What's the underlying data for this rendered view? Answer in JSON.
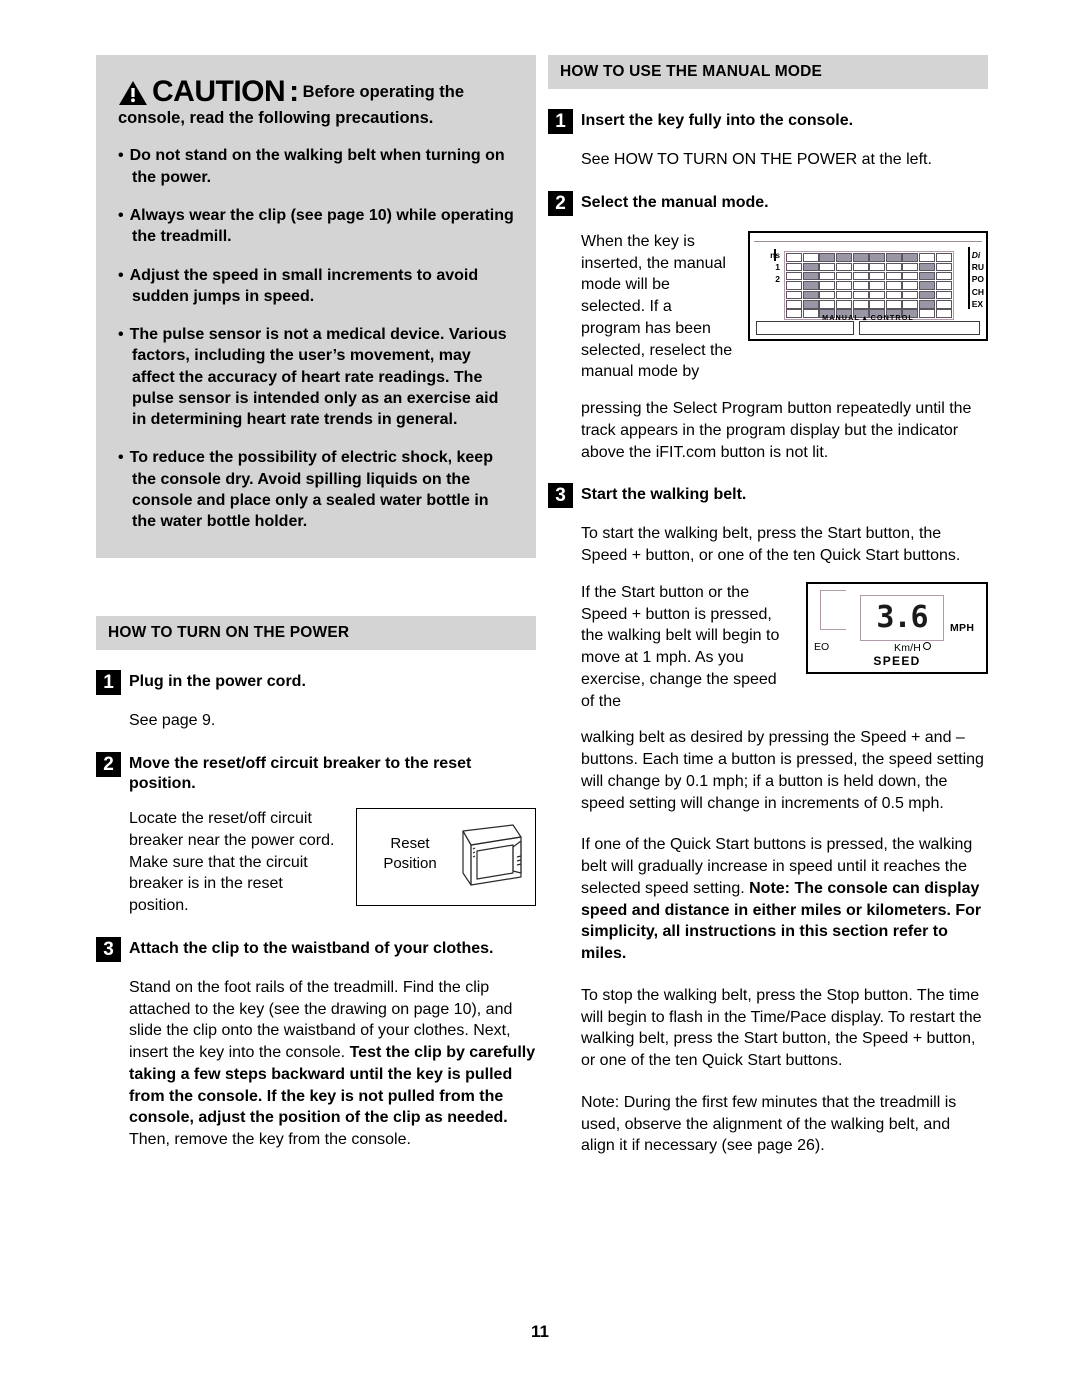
{
  "page": {
    "number": "11"
  },
  "left_column": {
    "caution": {
      "icon": "warning-triangle-icon",
      "word": "CAUTION",
      "colon": ":",
      "lead": "Before operating the",
      "sub": "console, read the following precautions.",
      "bullets": [
        "Do not stand on the walking belt when turning on the power.",
        "Always wear the clip (see page 10) while operating the treadmill.",
        "Adjust the speed in small increments to avoid sudden jumps in speed.",
        "The pulse sensor is not a medical device. Various factors, including the user’s movement, may affect the accuracy of heart rate readings. The pulse sensor is intended only as an exercise aid in determining heart rate trends in general.",
        "To reduce the possibility of electric shock, keep the console dry. Avoid spilling liquids on the console and place only a sealed water bottle in the water bottle holder."
      ]
    },
    "power_section": {
      "header": "HOW TO TURN ON THE POWER",
      "steps": [
        {
          "num": "1",
          "title": "Plug in the power cord.",
          "body": "See page 9."
        },
        {
          "num": "2",
          "title": "Move the reset/off circuit breaker to the reset position.",
          "body": "Locate the reset/off circuit breaker near the power cord. Make sure that the circuit breaker is in the reset position."
        },
        {
          "num": "3",
          "title": "Attach the clip to the waistband of your clothes.",
          "body_part1": "Stand on the foot rails of the treadmill. Find the clip attached to the key (see the drawing on page 10), and slide the clip onto the waistband of your clothes. Next, insert the key into the console. ",
          "body_bold": "Test the clip by carefully taking a few steps backward until the key is pulled from the console. If the key is not pulled from the console, adjust the position of the clip as needed.",
          "body_part2": " Then, remove the key from the console."
        }
      ],
      "reset_figure": {
        "label_line1": "Reset",
        "label_line2": "Position",
        "name": "reset-position-illustration"
      }
    }
  },
  "right_column": {
    "manual_section": {
      "header": "HOW TO USE THE MANUAL MODE",
      "steps": [
        {
          "num": "1",
          "title": "Insert the key fully into the console.",
          "body": "See HOW TO TURN ON THE POWER at the left."
        },
        {
          "num": "2",
          "title": "Select the manual mode.",
          "body_wrap": "When the key is inserted, the manual mode will be selected. If a program has been selected, reselect the manual mode by",
          "body_full": "pressing the Select Program button repeatedly until the track appears in the program display but the indicator above the iFIT.com button is not lit."
        },
        {
          "num": "3",
          "title": "Start the walking belt.",
          "body1": "To start the walking belt, press the Start button, the Speed + button, or one of the ten Quick Start buttons.",
          "body2_wrap": "If the Start button or the Speed + button is pressed, the walking belt will begin to move at 1 mph. As you exercise, change the speed of the",
          "body2_full": "walking belt as desired by pressing the Speed + and – buttons. Each time a button is pressed, the speed setting will change by 0.1 mph; if a button is held down, the speed setting will change in increments of 0.5 mph.",
          "body3_part1": "If one of the Quick Start buttons is pressed, the walking belt will gradually increase in speed until it reaches the selected speed setting. ",
          "body3_bold": "Note: The console can display speed and distance in either miles or kilometers. For simplicity, all instructions in this section refer to miles.",
          "body4": "To stop the walking belt, press the Stop button. The time will begin to flash in the Time/Pace display. To restart the walking belt, press the Start button, the Speed + button, or one of the ten Quick Start buttons.",
          "body5": "Note: During the first few minutes that the treadmill is used, observe the alignment of the walking belt, and align it if necessary (see page 26)."
        }
      ],
      "console_figure": {
        "name": "console-program-display-illustration",
        "manual_control_label": "MANUAL ▴ CONTROL",
        "left_labels": [
          "ns",
          "1",
          "2"
        ],
        "right_labels": [
          "Di",
          "RU",
          "PO",
          "CH",
          "EX"
        ]
      },
      "speed_figure": {
        "name": "speed-display-illustration",
        "value": "3.6",
        "unit_mph": "MPH",
        "unit_kmh": "Km/H",
        "title": "SPEED",
        "side_label": "EO"
      }
    }
  },
  "colors": {
    "panel_gray": "#d4d4d4",
    "text": "#000000",
    "lcd_segment": "#1a1a1a",
    "grid_on": "#9a96a6"
  }
}
